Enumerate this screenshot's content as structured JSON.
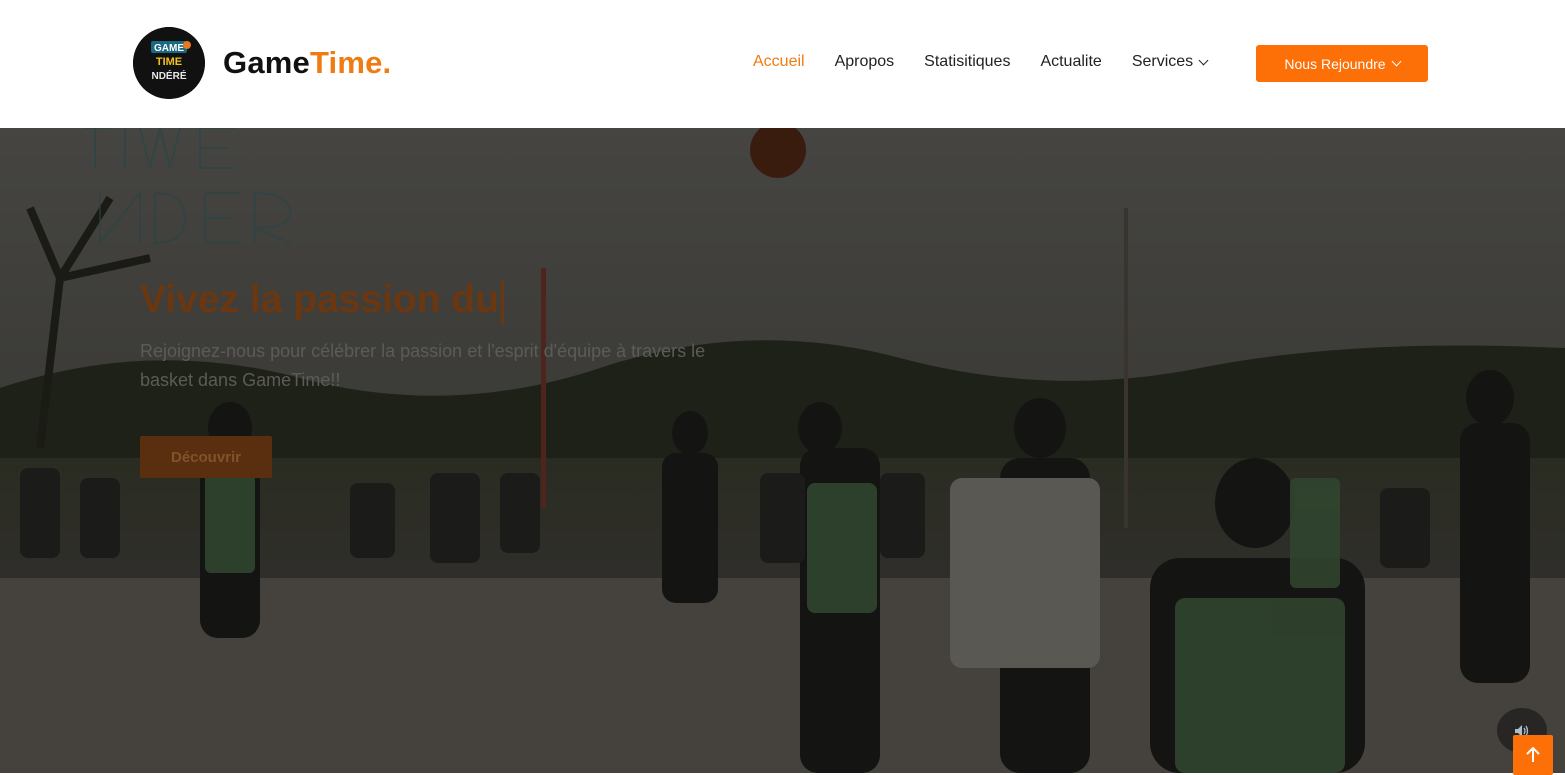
{
  "brand": {
    "name_part1": "Game",
    "name_part2": "Time.",
    "logo_text_1": "GAME",
    "logo_text_2": "TIME",
    "logo_text_3": "NDÉRÉ"
  },
  "nav": {
    "items": [
      {
        "label": "Accueil",
        "active": true
      },
      {
        "label": "Apropos"
      },
      {
        "label": "Statisitiques"
      },
      {
        "label": "Actualite"
      },
      {
        "label": "Services",
        "has_dropdown": true
      }
    ],
    "cta_label": "Nous Rejoundre"
  },
  "hero": {
    "title": "Vivez la passion du",
    "subtitle": "Rejoignez-nous pour célébrer la passion et l'esprit d'équipe à travers le basket dans GameTime!!",
    "button_label": "Découvrir"
  },
  "colors": {
    "accent": "#fd6f07",
    "brand_accent": "#f07b12"
  },
  "icons": {
    "sound": "speaker-icon",
    "scroll_top": "arrow-up-icon"
  }
}
